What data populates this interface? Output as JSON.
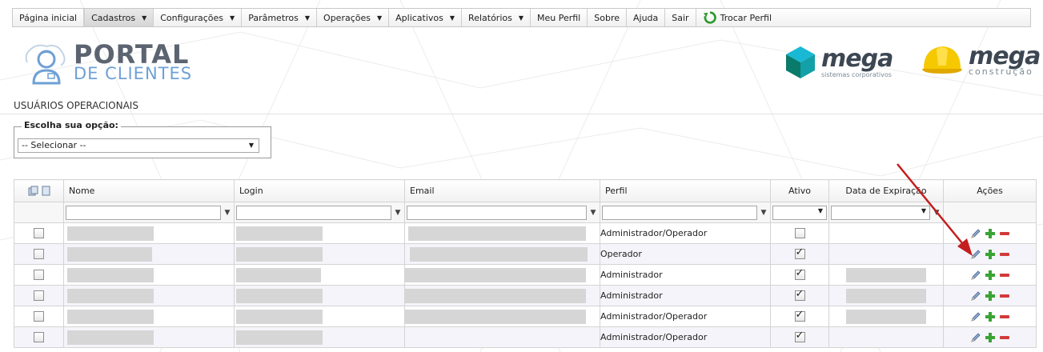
{
  "nav": {
    "items": [
      {
        "label": "Página inicial",
        "dropdown": false
      },
      {
        "label": "Cadastros",
        "dropdown": true,
        "active": true
      },
      {
        "label": "Configurações",
        "dropdown": true
      },
      {
        "label": "Parâmetros",
        "dropdown": true
      },
      {
        "label": "Operações",
        "dropdown": true
      },
      {
        "label": "Aplicativos",
        "dropdown": true
      },
      {
        "label": "Relatórios",
        "dropdown": true
      },
      {
        "label": "Meu Perfil",
        "dropdown": false
      },
      {
        "label": "Sobre",
        "dropdown": false
      },
      {
        "label": "Ajuda",
        "dropdown": false
      },
      {
        "label": "Sair",
        "dropdown": false
      }
    ],
    "switch_profile": "Trocar Perfil"
  },
  "logo": {
    "portal_line1": "PORTAL",
    "portal_line2": "DE CLIENTES",
    "mega1_word": "mega",
    "mega1_sub": "sistemas corporativos",
    "mega2_word": "mega",
    "mega2_sub": "construção"
  },
  "page": {
    "title": "USUÁRIOS OPERACIONAIS",
    "option_legend": "Escolha sua opção:",
    "option_selected": "-- Selecionar --"
  },
  "table": {
    "headers": {
      "nome": "Nome",
      "login": "Login",
      "email": "Email",
      "perfil": "Perfil",
      "ativo": "Ativo",
      "expiracao": "Data de Expiração",
      "acoes": "Ações"
    },
    "rows": [
      {
        "perfil": "Administrador/Operador",
        "ativo": false,
        "has_email": true,
        "has_exp": false
      },
      {
        "perfil": "Operador",
        "ativo": true,
        "has_email": true,
        "has_exp": false
      },
      {
        "perfil": "Administrador",
        "ativo": true,
        "has_email": true,
        "has_exp": true
      },
      {
        "perfil": "Administrador",
        "ativo": true,
        "has_email": true,
        "has_exp": true
      },
      {
        "perfil": "Administrador/Operador",
        "ativo": true,
        "has_email": true,
        "has_exp": true
      },
      {
        "perfil": "Administrador/Operador",
        "ativo": true,
        "has_email": false,
        "has_exp": false
      }
    ]
  },
  "colors": {
    "accent_red": "#cc1f1f",
    "edit_icon": "#4a6a9a",
    "add_icon": "#3aa335",
    "remove_icon": "#d33a3a",
    "redacted": "#d6d6d6"
  },
  "icons": [
    "pencil-icon",
    "plus-icon",
    "minus-icon",
    "filter-icon",
    "refresh-icon",
    "copy-icon",
    "document-icon"
  ]
}
